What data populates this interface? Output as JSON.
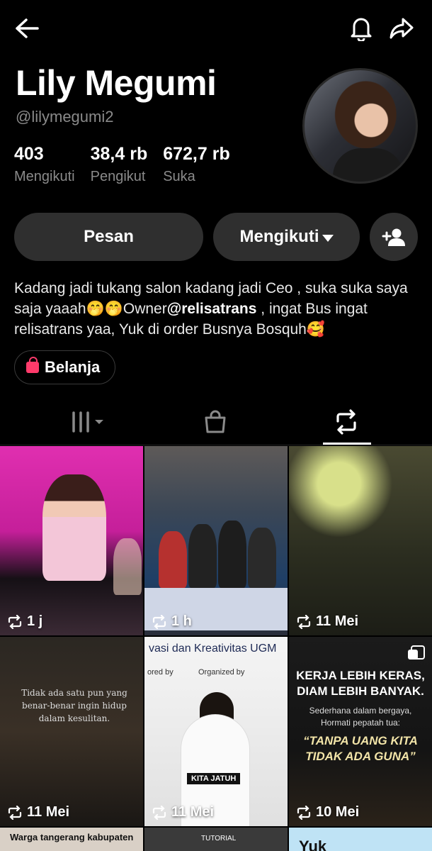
{
  "profile": {
    "name": "Lily Megumi",
    "handle": "@lilymegumi2",
    "stats": [
      {
        "value": "403",
        "label": "Mengikuti"
      },
      {
        "value": "38,4 rb",
        "label": "Pengikut"
      },
      {
        "value": "672,7 rb",
        "label": "Suka"
      }
    ]
  },
  "actions": {
    "message": "Pesan",
    "following": "Mengikuti"
  },
  "bio": {
    "part1": "Kadang jadi tukang salon kadang jadi Ceo , suka suka saya saja yaaah🤭🤭Owner",
    "mention": "@relisatrans",
    "part2": " , ingat Bus ingat relisatrans yaa, Yuk di order Busnya Bosquh🥰"
  },
  "shop": {
    "label": "Belanja"
  },
  "tabs": [
    {
      "icon": "grid-icon"
    },
    {
      "icon": "shopping-bag-icon"
    },
    {
      "icon": "repost-icon",
      "active": true
    }
  ],
  "videos": [
    {
      "time": "1 j"
    },
    {
      "time": "1 h"
    },
    {
      "time": "11 Mei"
    },
    {
      "time": "11 Mei",
      "overlay": "Tidak ada satu pun yang benar-benar ingin hidup dalam kesulitan."
    },
    {
      "time": "11 Mei",
      "header": "vasi dan Kreativitas UGM",
      "left_label": "ored by",
      "right_label": "Organized by",
      "caption": "KITA JATUH"
    },
    {
      "time": "10 Mei",
      "headline": "KERJA LEBIH KERAS, DIAM LEBIH BANYAK.",
      "sub": "Sederhana dalam bergaya, Hormati pepatah tua:",
      "quote": "“TANPA UANG KITA TIDAK ADA GUNA”"
    },
    {
      "strip": "Warga tangerang kabupaten"
    },
    {
      "strip": "TUTORIAL"
    },
    {
      "strip": "Yuk"
    }
  ]
}
